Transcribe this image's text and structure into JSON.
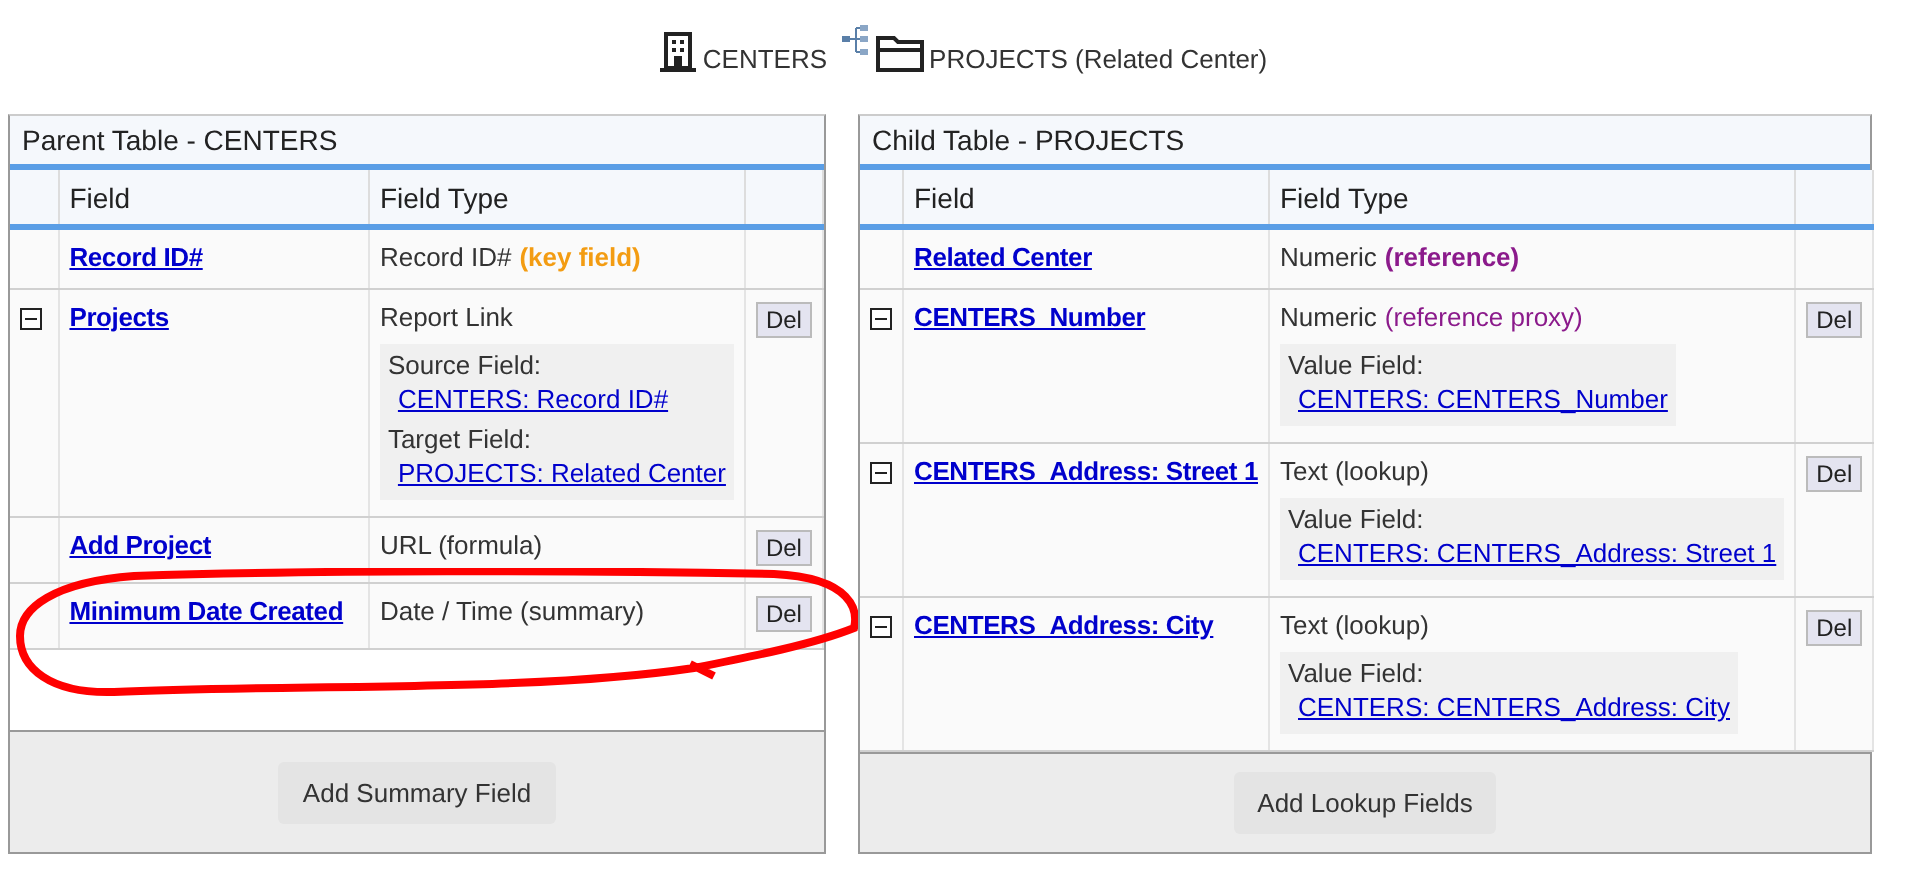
{
  "header": {
    "parent_label": "CENTERS",
    "child_label": "PROJECTS (Related Center)"
  },
  "panels": [
    {
      "title": "Parent Table - CENTERS",
      "columns": [
        "Field",
        "Field Type"
      ],
      "footer_button": "Add Summary Field",
      "annotated": true,
      "rows": [
        {
          "kind": "plain",
          "name": "Record ID#",
          "type": "Record ID#",
          "note": "(key field)",
          "note_bold": true,
          "color": "#f39c12"
        },
        {
          "kind": "expandable",
          "expanded": true,
          "name": "Projects",
          "type": "Report Link",
          "delete": "Del",
          "details": [
            {
              "label": "Source Field:",
              "value": "CENTERS: Record ID#"
            },
            {
              "label": "Target Field:",
              "value": "PROJECTS: Related Center"
            }
          ]
        },
        {
          "kind": "plain",
          "name": "Add Project",
          "type": "URL (formula)",
          "delete": "Del"
        },
        {
          "kind": "plain",
          "name": "Minimum Date Created",
          "type": "Date / Time (summary)",
          "delete": "Del"
        }
      ]
    },
    {
      "title": "Child Table - PROJECTS",
      "columns": [
        "Field",
        "Field Type"
      ],
      "footer_button": "Add Lookup Fields",
      "annotated": false,
      "rows": [
        {
          "kind": "plain",
          "name": "Related Center",
          "type": "Numeric",
          "note": "(reference)",
          "note_bold": true,
          "color": "#8b1a8b"
        },
        {
          "kind": "expandable",
          "expanded": true,
          "name": "CENTERS_Number",
          "type": "Numeric",
          "note": "(reference proxy)",
          "note_bold": false,
          "color": "#8b1a8b",
          "delete": "Del",
          "details": [
            {
              "label": "Value Field:",
              "value": "CENTERS: CENTERS_Number"
            }
          ]
        },
        {
          "kind": "expandable",
          "expanded": true,
          "name": "CENTERS_Address: Street 1",
          "type": "Text (lookup)",
          "delete": "Del",
          "details": [
            {
              "label": "Value Field:",
              "value": "CENTERS: CENTERS_Address: Street 1"
            }
          ]
        },
        {
          "kind": "expandable",
          "expanded": true,
          "name": "CENTERS_Address: City",
          "type": "Text (lookup)",
          "delete": "Del",
          "details": [
            {
              "label": "Value Field:",
              "value": "CENTERS: CENTERS_Address: City"
            }
          ]
        }
      ]
    }
  ]
}
